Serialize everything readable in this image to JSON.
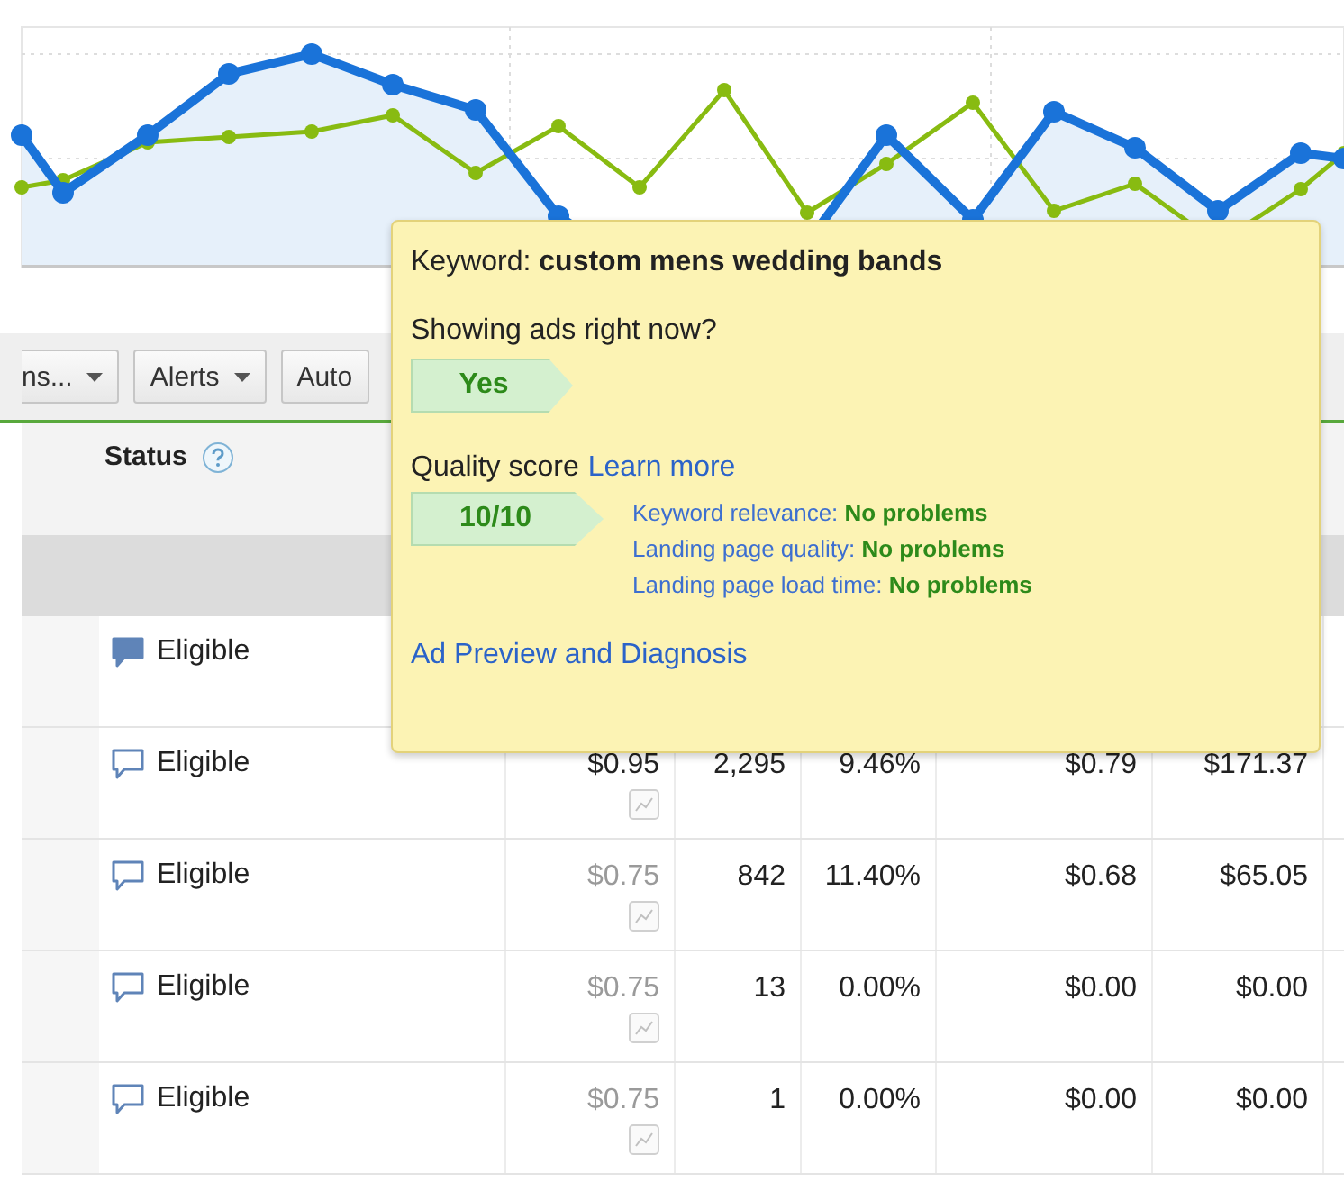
{
  "toolbar": {
    "buttons": [
      {
        "label": "ns...",
        "dropdown": true
      },
      {
        "label": "Alerts",
        "dropdown": true
      },
      {
        "label": "Auto",
        "dropdown": false
      }
    ]
  },
  "table": {
    "status_header": "Status",
    "rows": [
      {
        "status": "Eligible",
        "comment_filled": true
      },
      {
        "status": "Eligible",
        "comment_filled": false,
        "max_cpc": "$0.95",
        "max_cpc_muted": false,
        "clicks": "2,295",
        "ctr": "9.46%",
        "avg_cpc": "$0.79",
        "cost": "$171.37"
      },
      {
        "status": "Eligible",
        "comment_filled": false,
        "max_cpc": "$0.75",
        "max_cpc_muted": true,
        "clicks": "842",
        "ctr": "11.40%",
        "avg_cpc": "$0.68",
        "cost": "$65.05"
      },
      {
        "status": "Eligible",
        "comment_filled": false,
        "max_cpc": "$0.75",
        "max_cpc_muted": true,
        "clicks": "13",
        "ctr": "0.00%",
        "avg_cpc": "$0.00",
        "cost": "$0.00"
      },
      {
        "status": "Eligible",
        "comment_filled": false,
        "max_cpc": "$0.75",
        "max_cpc_muted": true,
        "clicks": "1",
        "ctr": "0.00%",
        "avg_cpc": "$0.00",
        "cost": "$0.00"
      }
    ]
  },
  "popup": {
    "keyword": "Keyword: **custom mens wedding bands**",
    "showing_question": "Showing ads right now?",
    "showing_answer": "Yes",
    "quality_label": "Quality score",
    "learn_more": "Learn more",
    "score": "10/10",
    "factors": [
      {
        "name": "Keyword relevance:",
        "value": "No problems"
      },
      {
        "name": "Landing page quality:",
        "value": "No problems"
      },
      {
        "name": "Landing page load time:",
        "value": "No problems"
      }
    ],
    "diagnosis_link": "Ad Preview and Diagnosis"
  }
}
